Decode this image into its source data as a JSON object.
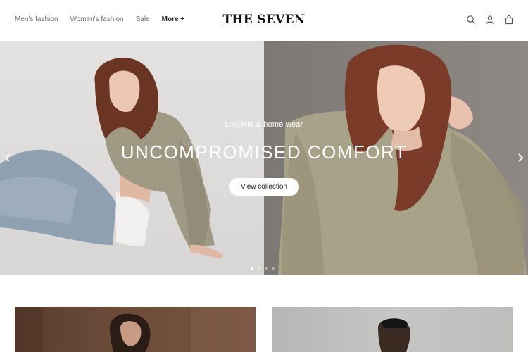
{
  "header": {
    "nav": [
      "Men's fashion",
      "Women's fashion",
      "Sale"
    ],
    "more_label": "More +",
    "logo": "THE SEVEN",
    "icons": [
      "search-icon",
      "account-icon",
      "bag-icon"
    ]
  },
  "hero": {
    "subtitle": "Lingerie & home wear",
    "title": "UNCOMPROMISED COMFORT",
    "button_label": "View collection",
    "slides_total": 4,
    "active_slide": 1
  },
  "colors": {
    "hero_text": "#ffffff",
    "button_bg": "#ffffff",
    "nav_text": "#6e6e6e",
    "logo": "#111111"
  }
}
